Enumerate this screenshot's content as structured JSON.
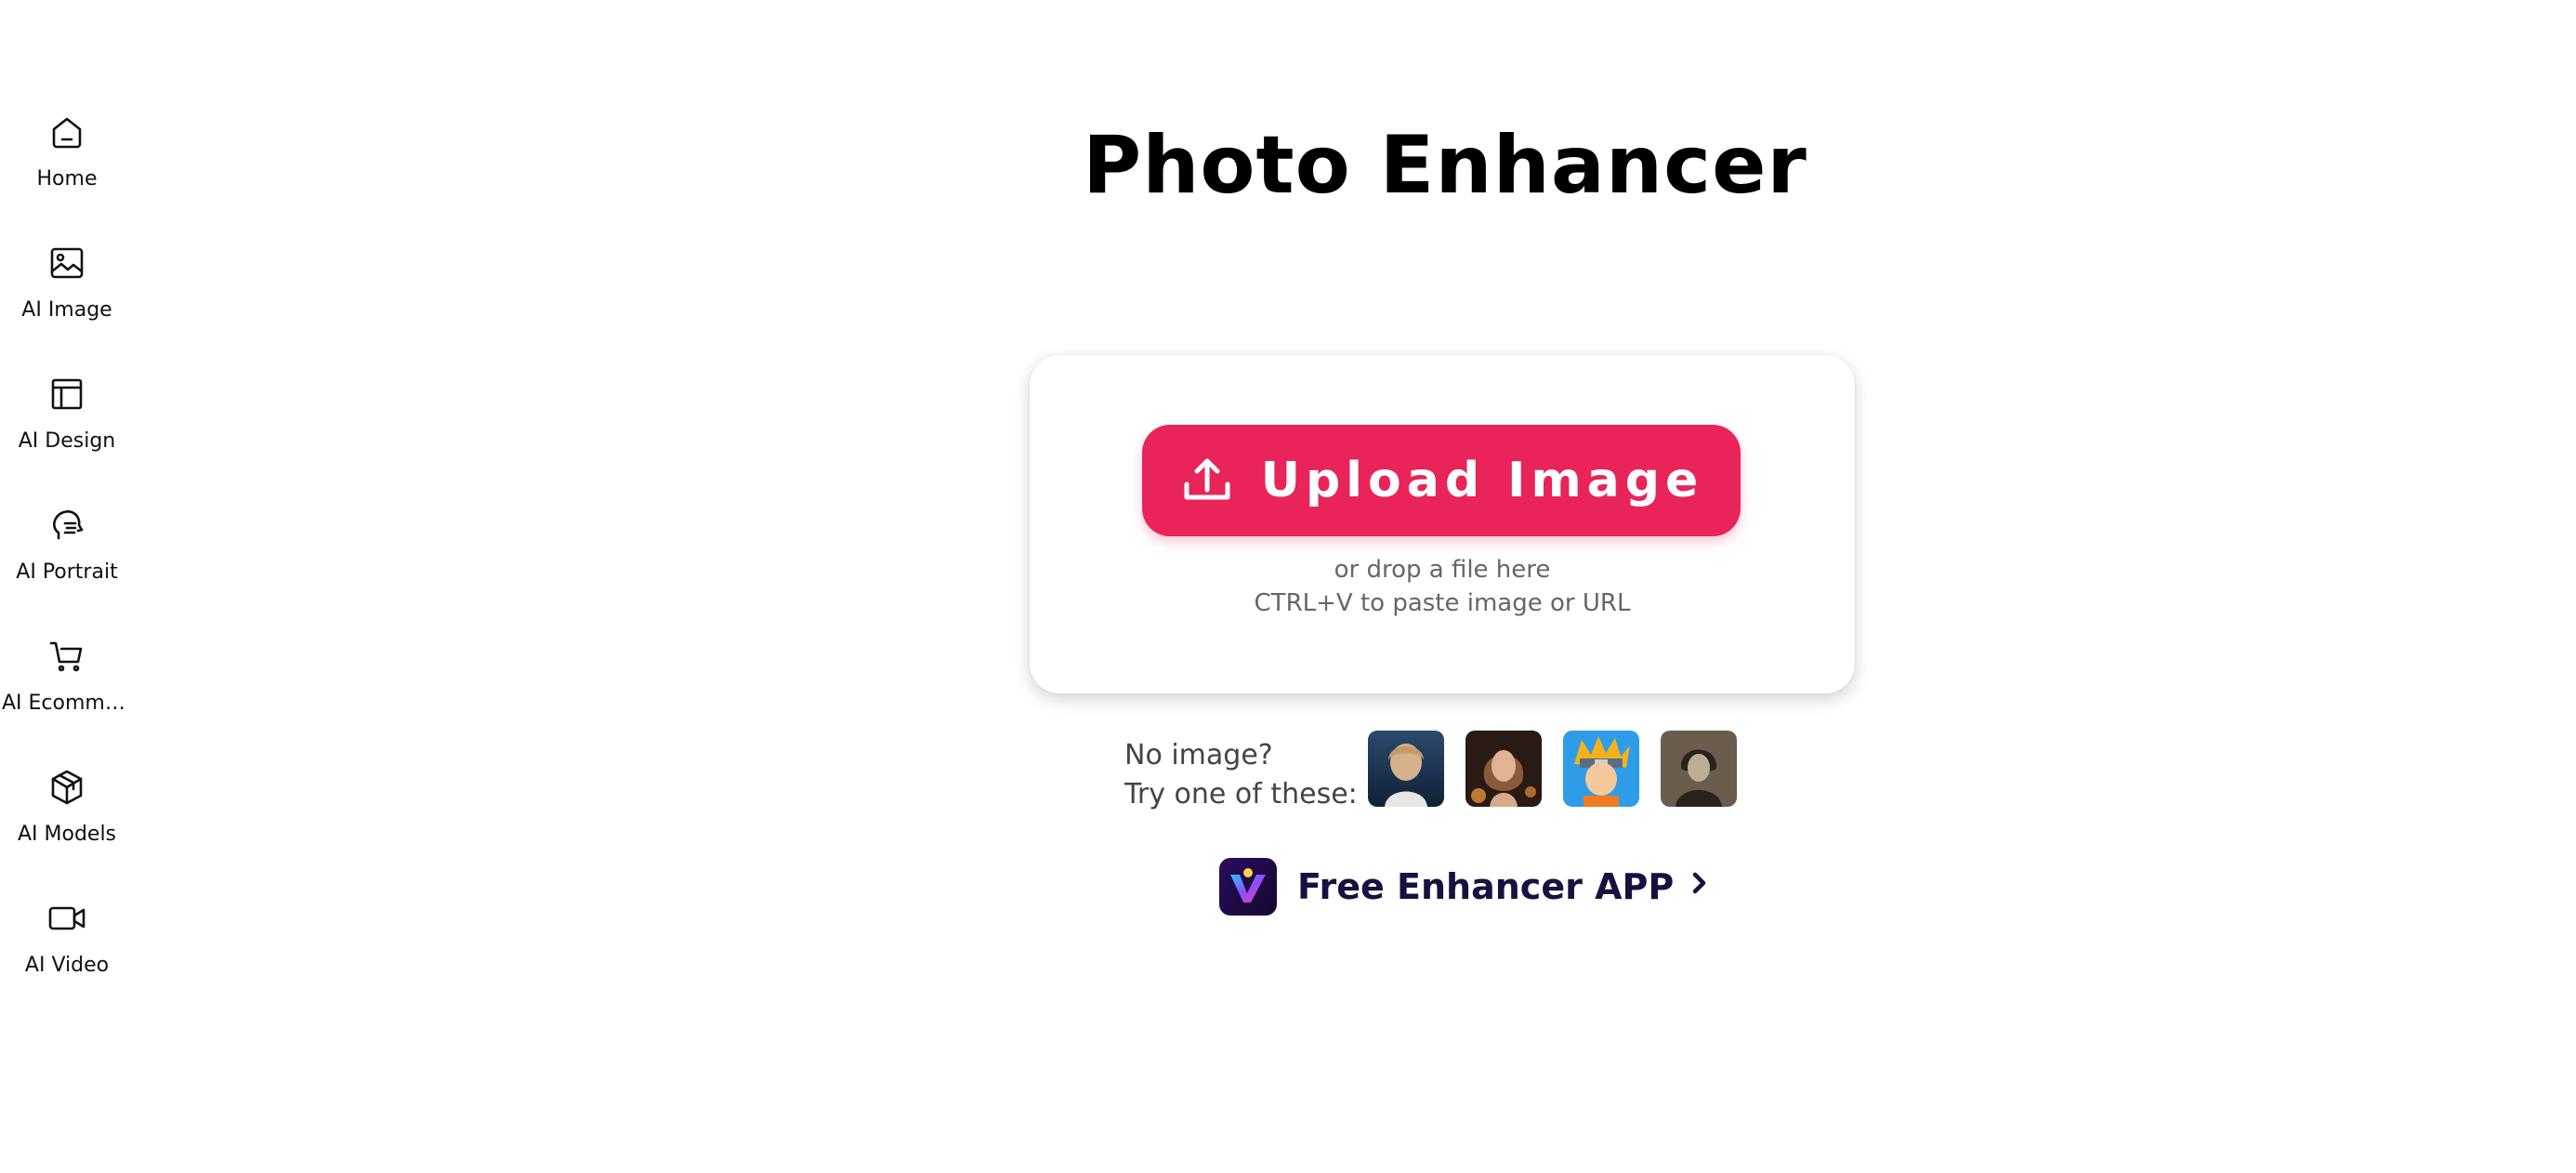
{
  "sidebar": {
    "items": [
      {
        "label": "Home",
        "icon": "home-icon"
      },
      {
        "label": "AI Image",
        "icon": "image-icon"
      },
      {
        "label": "AI Design",
        "icon": "layout-icon"
      },
      {
        "label": "AI Portrait",
        "icon": "portrait-icon"
      },
      {
        "label": "AI Ecommer...",
        "icon": "cart-icon"
      },
      {
        "label": "AI Models",
        "icon": "cube-icon"
      },
      {
        "label": "AI Video",
        "icon": "video-icon"
      }
    ]
  },
  "main": {
    "title": "Photo Enhancer",
    "upload": {
      "button_label": "Upload Image",
      "hint_drop": "or drop a file here",
      "hint_paste": "CTRL+V to paste image or URL"
    },
    "samples": {
      "line1": "No image?",
      "line2": "Try one of these:"
    },
    "app_link": {
      "label": "Free Enhancer APP"
    }
  },
  "colors": {
    "accent": "#e8245a",
    "app_text": "#1a1040"
  }
}
